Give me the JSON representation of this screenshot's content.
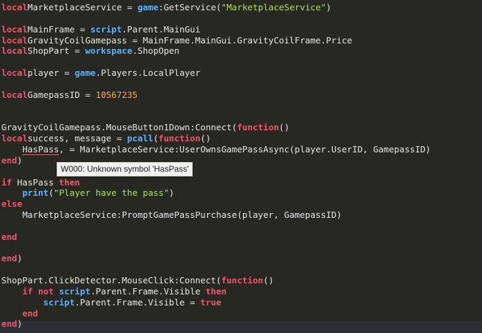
{
  "editor": {
    "lines": [
      [
        [
          "kw",
          "local"
        ],
        [
          "",
          "MarketplaceService = "
        ],
        [
          "gl",
          "game"
        ],
        [
          "",
          ":GetService("
        ],
        [
          "st",
          "\"MarketplaceService\""
        ],
        [
          "",
          ")"
        ]
      ],
      [],
      [
        [
          "kw",
          "local"
        ],
        [
          "",
          "MainFrame = "
        ],
        [
          "gl",
          "script"
        ],
        [
          "",
          ".Parent.MainGui"
        ]
      ],
      [
        [
          "kw",
          "local"
        ],
        [
          "",
          "GravityCoilGamepass = MainFrame.MainGui.GravityCoilFrame.Price"
        ]
      ],
      [
        [
          "kw",
          "local"
        ],
        [
          "",
          "ShopPart = "
        ],
        [
          "gl",
          "workspace"
        ],
        [
          "",
          ".ShopOpen"
        ]
      ],
      [],
      [
        [
          "kw",
          "local"
        ],
        [
          "",
          "player = "
        ],
        [
          "gl",
          "game"
        ],
        [
          "",
          ".Players.LocalPlayer"
        ]
      ],
      [],
      [
        [
          "kw",
          "local"
        ],
        [
          "",
          "GamepassID = "
        ],
        [
          "nm",
          "10567235"
        ]
      ],
      [],
      [],
      [
        [
          "",
          "GravityCoilGamepass.MouseButton1Down:Connect("
        ],
        [
          "kw",
          "function"
        ],
        [
          "",
          "()"
        ]
      ],
      [
        [
          "kw",
          "local"
        ],
        [
          "",
          "success, message = "
        ],
        [
          "fn",
          "pcall"
        ],
        [
          "",
          "("
        ],
        [
          "kw",
          "function"
        ],
        [
          "",
          "()"
        ]
      ],
      [
        [
          "",
          "    "
        ],
        [
          "warn",
          "HasPass"
        ],
        [
          "",
          ", = MarketplaceService:UserOwnsGamePassAsync(player.UserID, GamepassID)"
        ]
      ],
      [
        [
          "kw",
          "end"
        ],
        [
          "",
          ")"
        ]
      ],
      [],
      [
        [
          "kw",
          "if"
        ],
        [
          "",
          " HasPass "
        ],
        [
          "kw",
          "then"
        ]
      ],
      [
        [
          "",
          "    "
        ],
        [
          "fn",
          "print"
        ],
        [
          "",
          "("
        ],
        [
          "st",
          "\"Player have the pass\""
        ],
        [
          "",
          ")"
        ]
      ],
      [
        [
          "kw",
          "else"
        ]
      ],
      [
        [
          "",
          "    MarketplaceService:PromptGamePassPurchase(player, GamepassID)"
        ]
      ],
      [],
      [
        [
          "kw",
          "end"
        ]
      ],
      [],
      [
        [
          "kw",
          "end"
        ],
        [
          "",
          ")"
        ]
      ],
      [],
      [
        [
          "",
          "ShopPart.ClickDetector.MouseClick:Connect("
        ],
        [
          "kw",
          "function"
        ],
        [
          "",
          "()"
        ]
      ],
      [
        [
          "",
          "    "
        ],
        [
          "kw",
          "if not"
        ],
        [
          "",
          " "
        ],
        [
          "gl",
          "script"
        ],
        [
          "",
          ".Parent.Frame.Visible "
        ],
        [
          "kw",
          "then"
        ]
      ],
      [
        [
          "",
          "        "
        ],
        [
          "gl",
          "script"
        ],
        [
          "",
          ".Parent.Frame.Visible = "
        ],
        [
          "kw",
          "true"
        ]
      ],
      [
        [
          "",
          "    "
        ],
        [
          "kw",
          "end"
        ]
      ],
      [
        [
          "kw",
          "end"
        ],
        [
          "",
          ")"
        ]
      ]
    ]
  },
  "tooltip": {
    "text": "W000: Unknown symbol 'HasPass'"
  }
}
